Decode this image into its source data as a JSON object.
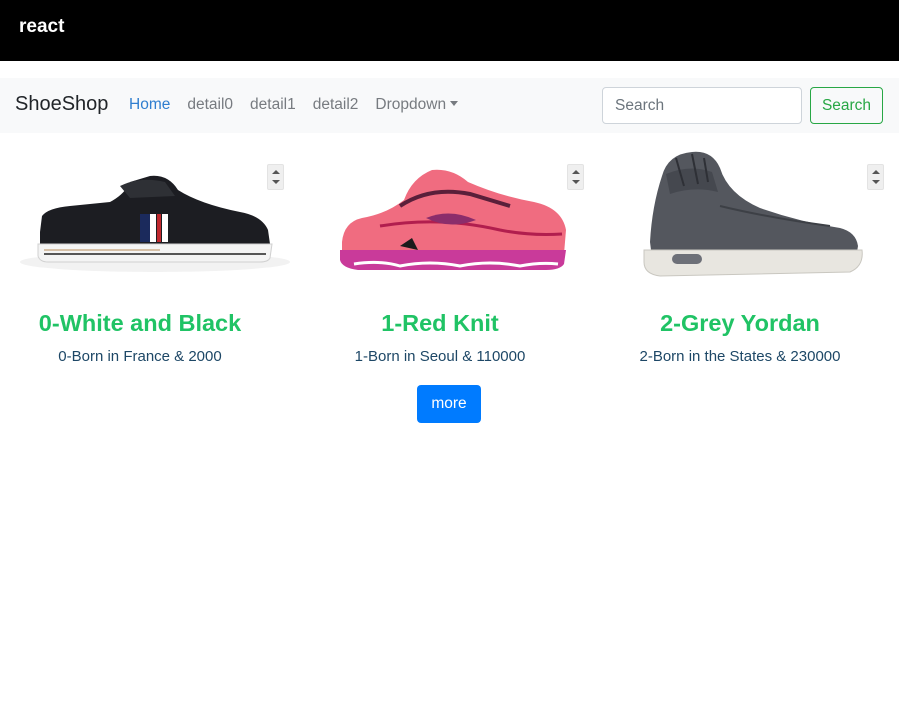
{
  "top_bar": {
    "title": "react"
  },
  "navbar": {
    "brand": "ShoeShop",
    "links": [
      {
        "label": "Home",
        "active": true
      },
      {
        "label": "detail0",
        "active": false
      },
      {
        "label": "detail1",
        "active": false
      },
      {
        "label": "detail2",
        "active": false
      }
    ],
    "dropdown_label": "Dropdown",
    "search": {
      "placeholder": "Search",
      "value": "",
      "button_label": "Search"
    }
  },
  "products": [
    {
      "title": "0-White and Black",
      "description": "0-Born in France & 2000",
      "image": "black-low-top-sneaker"
    },
    {
      "title": "1-Red Knit",
      "description": "1-Born in Seoul & 110000",
      "image": "pink-running-shoe"
    },
    {
      "title": "2-Grey Yordan",
      "description": "2-Born in the States & 230000",
      "image": "grey-high-top-sneaker"
    }
  ],
  "more_button": {
    "label": "more"
  },
  "colors": {
    "header_bg": "#000000",
    "navbar_bg": "#f8f9fa",
    "active_link": "#2f7ecf",
    "product_title": "#20c365",
    "product_desc": "#1d4766",
    "search_button": "#28a745",
    "more_button": "#007bff"
  }
}
